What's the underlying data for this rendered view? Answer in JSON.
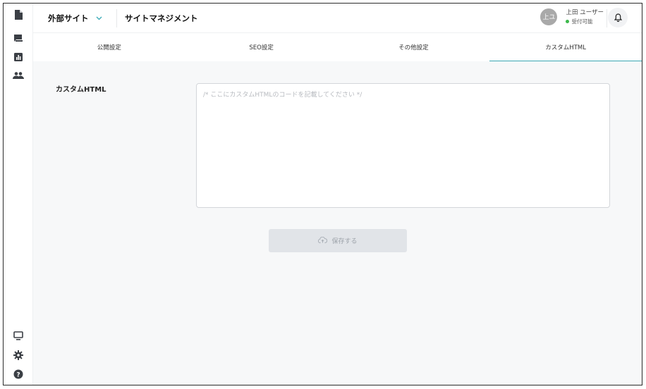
{
  "header": {
    "site_name": "外部サイト",
    "page_title": "サイトマネジメント",
    "user": {
      "avatar_text": "上ユ",
      "name": "上田 ユーザー",
      "status": "受付可能"
    }
  },
  "tabs": [
    {
      "label": "公開設定",
      "active": false
    },
    {
      "label": "SEO設定",
      "active": false
    },
    {
      "label": "その他設定",
      "active": false
    },
    {
      "label": "カスタムHTML",
      "active": true
    }
  ],
  "form": {
    "label": "カスタムHTML",
    "placeholder": "/* ここにカスタムHTMLのコードを記載してください */",
    "value": ""
  },
  "save_button": {
    "label": "保存する"
  },
  "colors": {
    "accent": "#3ba8b4",
    "status_online": "#3cb94b",
    "sidebar_icon": "#3b3f45",
    "button_disabled_bg": "#e1e4e8"
  },
  "icons": {
    "sidebar_top": [
      "document-icon",
      "chat-icon",
      "bar-chart-icon",
      "people-icon"
    ],
    "sidebar_bottom": [
      "monitor-icon",
      "gear-icon",
      "help-icon"
    ],
    "header": [
      "chevron-down-icon",
      "bell-icon"
    ],
    "save": "cloud-upload-icon"
  }
}
